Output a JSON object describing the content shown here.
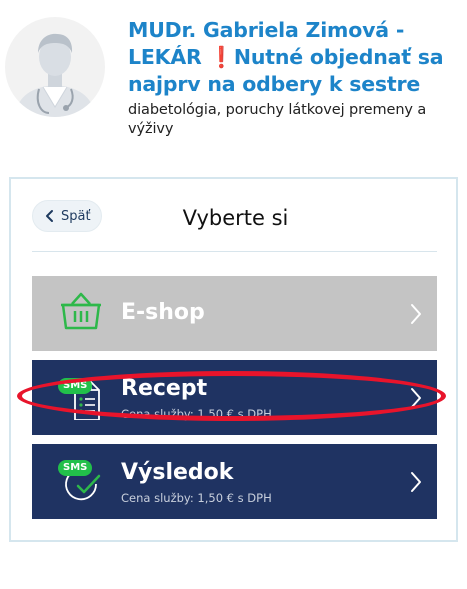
{
  "doctor": {
    "name_part1": "MUDr. Gabriela Zimová - LEKÁR ",
    "exclaim": "❗",
    "name_part2": "Nutné objednať sa najprv na odbery k sestre",
    "specialization": "diabetológia, poruchy látkovej premeny a výživy"
  },
  "panel": {
    "back_label": "Späť",
    "title": "Vyberte si"
  },
  "options": [
    {
      "label": "E-shop",
      "icon": "basket-icon",
      "price": ""
    },
    {
      "label": "Recept",
      "icon": "prescription-icon",
      "badge": "SMS",
      "price": "Cena služby: 1,50 € s DPH"
    },
    {
      "label": "Výsledok",
      "icon": "checkmark-icon",
      "badge": "SMS",
      "price": "Cena služby: 1,50 € s DPH"
    }
  ],
  "colors": {
    "name_blue": "#1d84c9",
    "option_navy": "#1f3362",
    "option_disabled": "#c4c4c4",
    "sms_green": "#22c04a",
    "annotation_red": "#e8142b"
  }
}
